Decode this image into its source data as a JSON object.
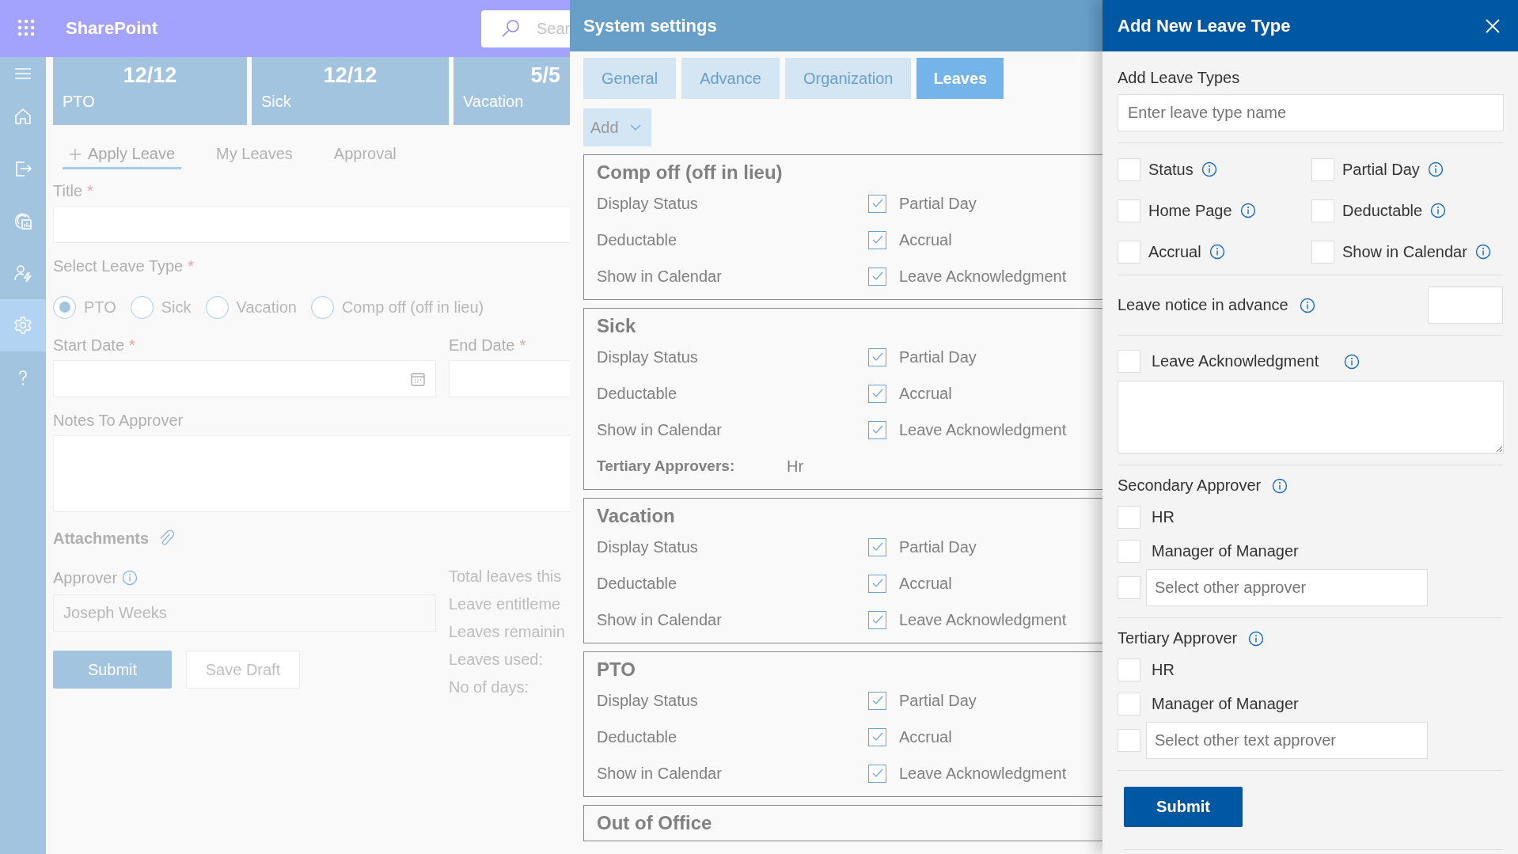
{
  "app_bar": {
    "app_name": "SharePoint",
    "search": {
      "placeholder": "Sear"
    }
  },
  "nav_rail": [
    {
      "kind": "menu",
      "selected": false
    },
    {
      "kind": "home",
      "selected": false
    },
    {
      "kind": "exit",
      "selected": false
    },
    {
      "kind": "report",
      "selected": false
    },
    {
      "kind": "user",
      "selected": false
    },
    {
      "kind": "settings",
      "selected": true
    },
    {
      "kind": "help",
      "selected": false
    }
  ],
  "summary_cards": [
    {
      "count": "12/12",
      "label": "PTO"
    },
    {
      "count": "12/12",
      "label": "Sick"
    },
    {
      "count": "5/5",
      "label": "Vacation"
    }
  ],
  "tabs": [
    {
      "label": "Apply Leave",
      "selected": true,
      "add_icon": true
    },
    {
      "label": "My Leaves",
      "selected": false,
      "add_icon": false
    },
    {
      "label": "Approval",
      "selected": false,
      "add_icon": false
    }
  ],
  "form": {
    "title": {
      "label": "Title",
      "required_mark": "*"
    },
    "leave_type": {
      "label": "Select Leave Type",
      "required_mark": "*",
      "options": [
        {
          "label": "PTO",
          "selected": true
        },
        {
          "label": "Sick",
          "selected": false
        },
        {
          "label": "Vacation",
          "selected": false
        },
        {
          "label": "Comp off (off in lieu)",
          "selected": false
        }
      ]
    },
    "start_date": {
      "label": "Start Date",
      "required_mark": "*"
    },
    "end_date": {
      "label": "End Date",
      "required_mark": "*"
    },
    "notes": {
      "label": "Notes To Approver"
    },
    "attachments": {
      "label": "Attachments"
    },
    "approver": {
      "label": "Approver",
      "value": "Joseph Weeks"
    },
    "summary": [
      "Total leaves this",
      "Leave entitleme",
      "Leaves remainin",
      "Leaves used:",
      "No of days:"
    ],
    "buttons": [
      {
        "label": "Submit",
        "kind": "primary"
      },
      {
        "label": "Save Draft",
        "kind": "secondary"
      }
    ]
  },
  "system_settings": {
    "title": "System settings",
    "tabs": [
      {
        "label": "General",
        "selected": false
      },
      {
        "label": "Advance",
        "selected": false
      },
      {
        "label": "Organization",
        "selected": false
      },
      {
        "label": "Leaves",
        "selected": true
      }
    ],
    "add_button": {
      "label": "Add"
    },
    "leave_types": [
      {
        "name": "Comp off (off in lieu)",
        "rows": [
          {
            "label": "Display Status",
            "option": {
              "label": "Partial Day",
              "checked": true
            }
          },
          {
            "label": "Deductable",
            "option": {
              "label": "Accrual",
              "checked": true
            }
          },
          {
            "label": "Show in Calendar",
            "option": {
              "label": "Leave Acknowledgment",
              "checked": true
            }
          }
        ]
      },
      {
        "name": "Sick",
        "rows": [
          {
            "label": "Display Status",
            "option": {
              "label": "Partial Day",
              "checked": true
            }
          },
          {
            "label": "Deductable",
            "option": {
              "label": "Accrual",
              "checked": true
            }
          },
          {
            "label": "Show in Calendar",
            "option": {
              "label": "Leave Acknowledgment",
              "checked": true
            }
          }
        ],
        "approvers": {
          "label": "Tertiary Approvers:",
          "value": "Hr"
        }
      },
      {
        "name": "Vacation",
        "rows": [
          {
            "label": "Display Status",
            "option": {
              "label": "Partial Day",
              "checked": true
            }
          },
          {
            "label": "Deductable",
            "option": {
              "label": "Accrual",
              "checked": true
            }
          },
          {
            "label": "Show in Calendar",
            "option": {
              "label": "Leave Acknowledgment",
              "checked": true
            }
          }
        ]
      },
      {
        "name": "PTO",
        "rows": [
          {
            "label": "Display Status",
            "option": {
              "label": "Partial Day",
              "checked": true
            }
          },
          {
            "label": "Deductable",
            "option": {
              "label": "Accrual",
              "checked": true
            }
          },
          {
            "label": "Show in Calendar",
            "option": {
              "label": "Leave Acknowledgment",
              "checked": true
            }
          }
        ]
      },
      {
        "name": "Out of Office"
      }
    ]
  },
  "add_panel": {
    "title": "Add New Leave Type",
    "name_label": "Add Leave Types",
    "name_field": {
      "placeholder": "Enter leave type name"
    },
    "options": [
      {
        "label": "Status",
        "checked": false
      },
      {
        "label": "Partial Day",
        "checked": false
      },
      {
        "label": "Home Page",
        "checked": false
      },
      {
        "label": "Deductable",
        "checked": false
      },
      {
        "label": "Accrual",
        "checked": false
      },
      {
        "label": "Show in Calendar",
        "checked": false
      }
    ],
    "notice": {
      "label": "Leave notice in advance"
    },
    "acknowledgment": {
      "label": "Leave Acknowledgment",
      "checked": false
    },
    "secondary": {
      "label": "Secondary Approver",
      "options": [
        {
          "label": "HR",
          "checked": false
        },
        {
          "label": "Manager of Manager",
          "checked": false
        }
      ],
      "other": {
        "placeholder": "Select other approver",
        "checked": false
      }
    },
    "tertiary": {
      "label": "Tertiary Approver",
      "options": [
        {
          "label": "HR",
          "checked": false
        },
        {
          "label": "Manager of Manager",
          "checked": false
        }
      ],
      "other": {
        "placeholder": "Select other text approver",
        "checked": false
      }
    },
    "submit": {
      "label": "Submit"
    }
  }
}
